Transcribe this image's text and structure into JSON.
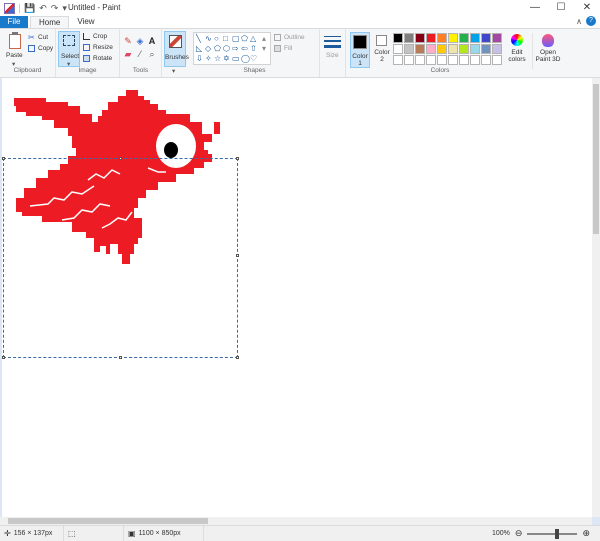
{
  "window": {
    "title": "Untitled - Paint",
    "min_glyph": "—",
    "max_glyph": "☐",
    "close_glyph": "✕"
  },
  "quick_access": {
    "save_glyph": "💾",
    "undo_glyph": "↶",
    "redo_glyph": "↷",
    "dropdown_glyph": "▾"
  },
  "tabs": {
    "file": "File",
    "home": "Home",
    "view": "View"
  },
  "help_glyph": "?",
  "collapse_glyph": "∧",
  "ribbon": {
    "clipboard": {
      "label": "Clipboard",
      "paste": "Paste",
      "cut": "Cut",
      "copy": "Copy"
    },
    "image": {
      "label": "Image",
      "select": "Select",
      "crop": "Crop",
      "resize": "Resize",
      "rotate": "Rotate"
    },
    "tools": {
      "label": "Tools",
      "brushes": "Brushes",
      "text_glyph": "A"
    },
    "shapes": {
      "label": "Shapes",
      "outline": "Outline",
      "fill": "Fill"
    },
    "size": {
      "label": "Size"
    },
    "colors": {
      "label": "Colors",
      "color1": "Color 1",
      "color2": "Color 2",
      "color1_value": "#000000",
      "color2_value": "#ffffff",
      "edit_colors": "Edit colors",
      "open_paint3d": "Open Paint 3D",
      "palette_row1": [
        "#000000",
        "#7f7f7f",
        "#880015",
        "#ed1c24",
        "#ff7f27",
        "#fff200",
        "#22b14c",
        "#00a2e8",
        "#3f48cc",
        "#a349a4"
      ],
      "palette_row2": [
        "#ffffff",
        "#c3c3c3",
        "#b97a57",
        "#ffaec9",
        "#ffc90e",
        "#efe4b0",
        "#b5e61d",
        "#99d9ea",
        "#7092be",
        "#c8bfe7"
      ],
      "palette_row3": [
        "#ffffff",
        "#ffffff",
        "#ffffff",
        "#ffffff",
        "#ffffff",
        "#ffffff",
        "#ffffff",
        "#ffffff",
        "#ffffff",
        "#ffffff"
      ]
    }
  },
  "drawing": {
    "creature_color": "#ed1c24",
    "eye_white": "#ffffff",
    "pupil_color": "#000000"
  },
  "status": {
    "cursor_position": "156 × 137px",
    "image_size": "1100 × 850px",
    "zoom": "100%",
    "zoom_out_glyph": "⊖",
    "zoom_in_glyph": "⊕"
  }
}
